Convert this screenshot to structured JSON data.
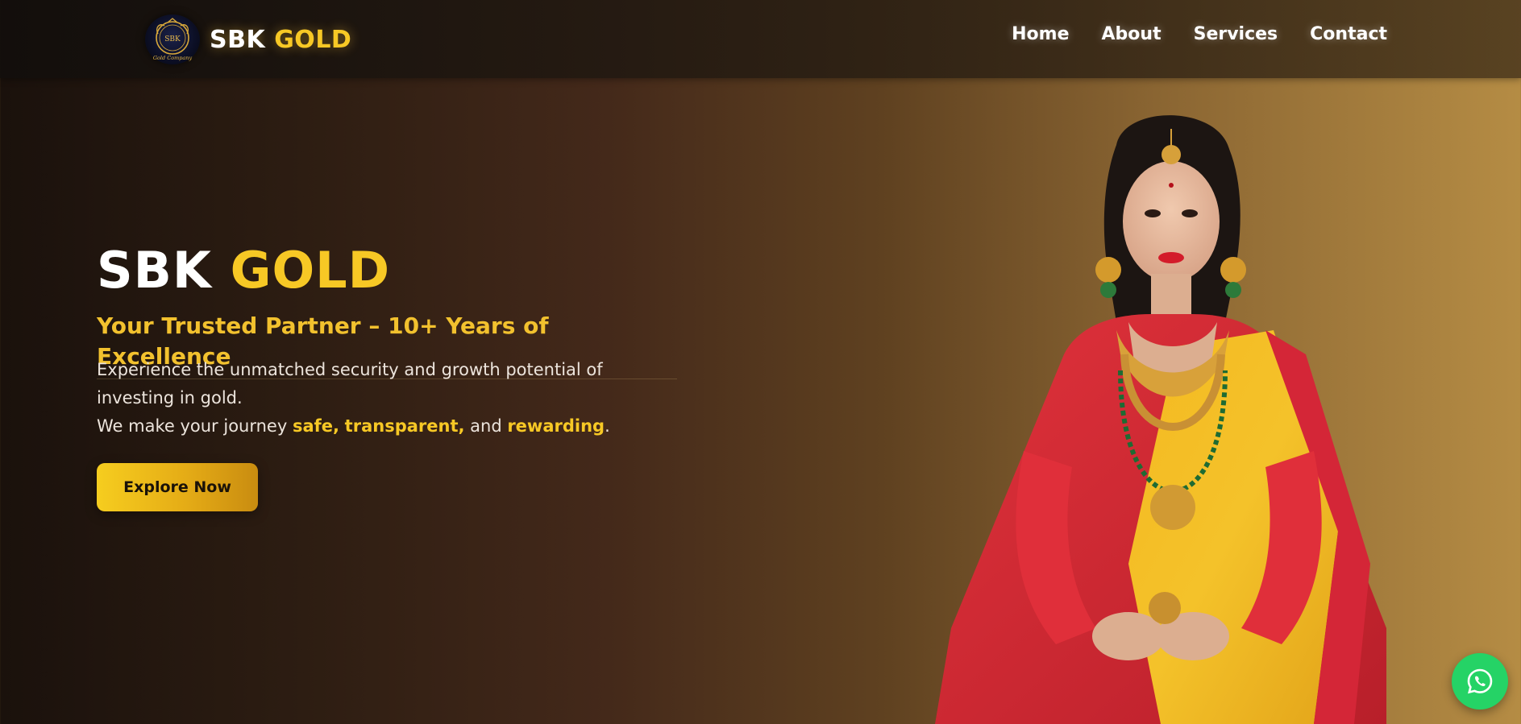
{
  "brand": {
    "word1": "SBK",
    "word2": "GOLD",
    "emblem_text": "SBK",
    "emblem_caption": "Gold Company",
    "icon": "crest-logo-icon"
  },
  "nav": {
    "items": [
      {
        "label": "Home"
      },
      {
        "label": "About"
      },
      {
        "label": "Services"
      },
      {
        "label": "Contact"
      }
    ]
  },
  "hero": {
    "title_word1": "SBK",
    "title_word2": "GOLD",
    "subtitle": "Your Trusted Partner – 10+ Years of Excellence",
    "desc_line1": "Experience the unmatched security and growth potential of investing in gold.",
    "desc_line2_prefix": "We make your journey ",
    "desc_hl1": "safe,",
    "desc_hl2": "transparent,",
    "desc_and": " and ",
    "desc_hl3": "rewarding",
    "desc_end": ".",
    "cta_label": "Explore Now"
  },
  "floating": {
    "whatsapp_icon": "whatsapp-icon"
  },
  "colors": {
    "gold": "#f7c825",
    "whatsapp": "#25d366"
  }
}
